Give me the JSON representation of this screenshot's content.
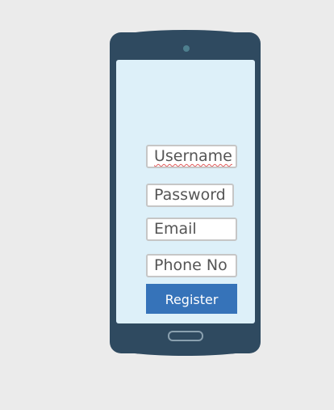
{
  "form": {
    "fields": [
      {
        "value": "Username"
      },
      {
        "value": "Password"
      },
      {
        "value": "Email"
      },
      {
        "value": "Phone No"
      }
    ],
    "register_label": "Register"
  },
  "colors": {
    "background": "#ebebeb",
    "phone_body": "#2f4a60",
    "screen": "#ddf0f9",
    "register_button": "#3673b9"
  },
  "icons": [
    "camera-icon",
    "home-button-icon"
  ]
}
